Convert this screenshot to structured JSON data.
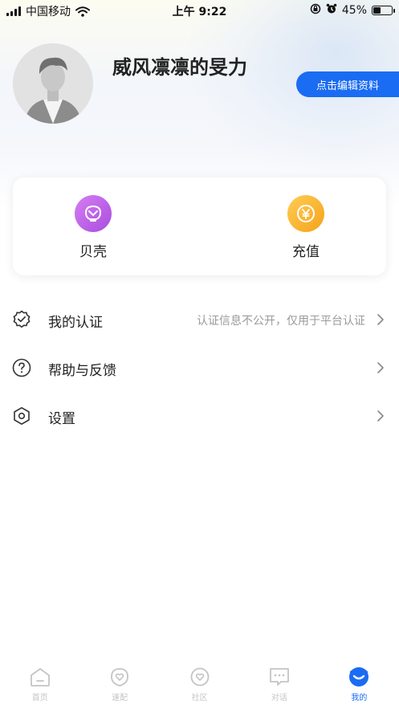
{
  "status_bar": {
    "carrier": "中国移动",
    "time": "上午 9:22",
    "battery_percent": "45%",
    "battery_level": 0.45
  },
  "profile": {
    "username": "威风凛凛的旻力",
    "edit_label": "点击编辑资料"
  },
  "wallet": {
    "shell_label": "贝壳",
    "recharge_label": "充值",
    "shell_icon": "shell-icon",
    "recharge_icon": "yen-coin-icon"
  },
  "menu": {
    "items": [
      {
        "label": "我的认证",
        "hint": "认证信息不公开，仅用于平台认证",
        "icon": "verified-badge-icon"
      },
      {
        "label": "帮助与反馈",
        "hint": "",
        "icon": "question-circle-icon"
      },
      {
        "label": "设置",
        "hint": "",
        "icon": "hexagon-settings-icon"
      }
    ]
  },
  "tabbar": {
    "tabs": [
      {
        "label": "首页",
        "icon": "home-icon",
        "active": false
      },
      {
        "label": "速配",
        "icon": "heart-match-icon",
        "active": false
      },
      {
        "label": "社区",
        "icon": "heart-community-icon",
        "active": false
      },
      {
        "label": "对话",
        "icon": "chat-icon",
        "active": false
      },
      {
        "label": "我的",
        "icon": "profile-icon",
        "active": true
      }
    ]
  },
  "colors": {
    "accent": "#1a6cf3",
    "shell_purple": "#b55ee8",
    "recharge_orange": "#f8b134",
    "inactive_tab": "#c4c4c4"
  }
}
